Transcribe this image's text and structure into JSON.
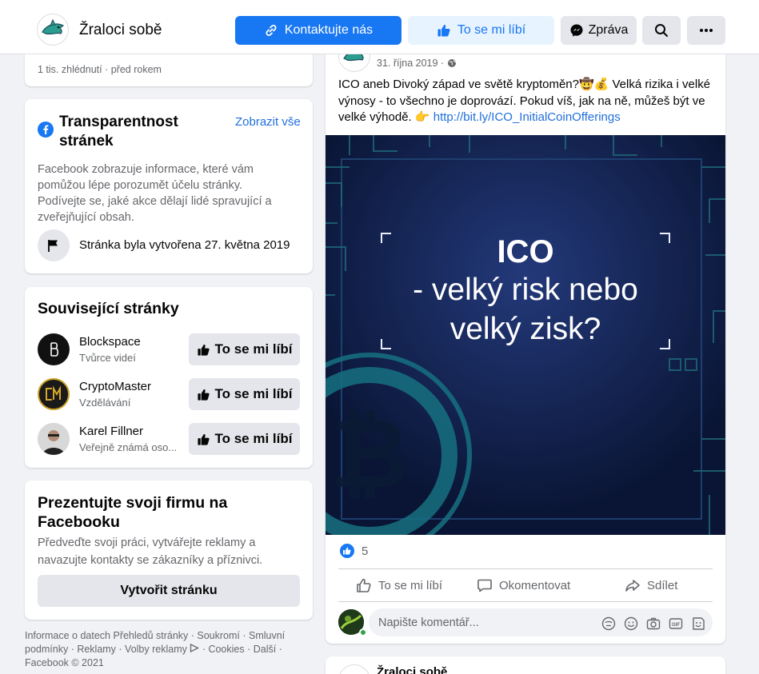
{
  "header": {
    "page_name": "Žraloci sobě",
    "contact_label": "Kontaktujte nás",
    "like_label": "To se mi líbí",
    "message_label": "Zpráva"
  },
  "video_card": {
    "meta": "1 tis. zhlédnutí · před rokem"
  },
  "transparency": {
    "title_line1": "Transparentnost",
    "title_line2": "stránek",
    "see_all": "Zobrazit vše",
    "description_lines": [
      "Facebook zobrazuje informace, které vám",
      "pomůžou lépe porozumět účelu stránky.",
      "Podívejte se, jaké akce dělají lidé spravující a",
      "zveřejňující obsah."
    ],
    "created": "Stránka byla vytvořena 27. května 2019"
  },
  "related": {
    "title": "Související stránky",
    "like_label": "To se mi líbí",
    "items": [
      {
        "name": "Blockspace",
        "category": "Tvůrce videí"
      },
      {
        "name": "CryptoMaster",
        "category": "Vzdělávání"
      },
      {
        "name": "Karel Fillner",
        "category": "Veřejně známá oso..."
      }
    ]
  },
  "promo": {
    "title_line1": "Prezentujte svoji firmu na",
    "title_line2": "Facebooku",
    "text_line1": "Předveďte svoji práci, vytvářejte reklamy a",
    "text_line2": "navazujte kontakty se zákazníky a příznivci.",
    "button": "Vytvořit stránku"
  },
  "footer": {
    "links": [
      "Informace o datech Přehledů stránky",
      "Soukromí",
      "Smluvní podmínky",
      "Reklamy",
      "Volby reklamy",
      "Cookies",
      "Další"
    ],
    "copyright": "Facebook © 2021"
  },
  "post": {
    "date": "31. října 2019 ·",
    "text_line1": "ICO aneb Divoký západ ve světě kryptoměn?🤠💰 Velká rizika i velké",
    "text_line2": "výnosy - to všechno je doprovází. Pokud víš, jak na ně, můžeš být ve",
    "text_line3_prefix": "velké výhodě. 👉",
    "link": "http://bit.ly/ICO_InitialCoinOfferings",
    "image_title": "ICO",
    "image_line2": "- velký risk nebo",
    "image_line3": "velký zisk?",
    "reactions_count": "5",
    "like_action": "To se mi líbí",
    "comment_action": "Okomentovat",
    "share_action": "Sdílet",
    "comment_placeholder": "Napište komentář..."
  },
  "next_post": {
    "page_name": "Žraloci sobě"
  },
  "colors": {
    "accent": "#1877f2",
    "background": "#f0f2f5",
    "image_bg": "#0f1e45"
  }
}
